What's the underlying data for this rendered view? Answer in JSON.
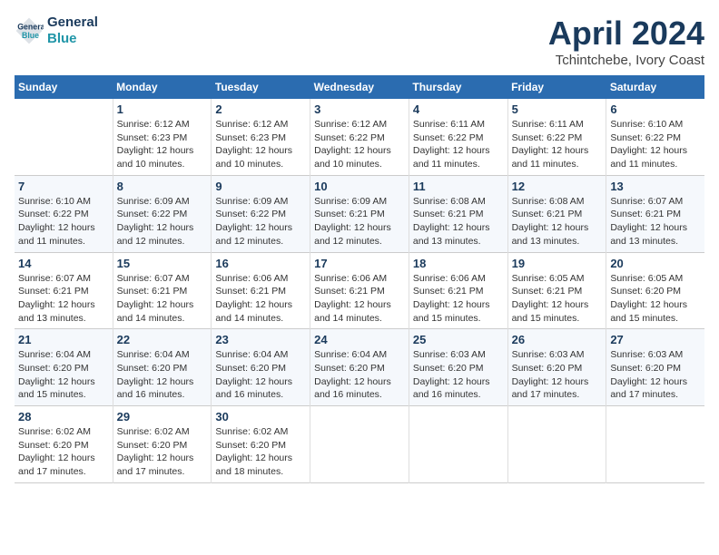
{
  "header": {
    "logo_line1": "General",
    "logo_line2": "Blue",
    "month_title": "April 2024",
    "location": "Tchintchebe, Ivory Coast"
  },
  "weekdays": [
    "Sunday",
    "Monday",
    "Tuesday",
    "Wednesday",
    "Thursday",
    "Friday",
    "Saturday"
  ],
  "weeks": [
    [
      {
        "num": "",
        "info": ""
      },
      {
        "num": "1",
        "info": "Sunrise: 6:12 AM\nSunset: 6:23 PM\nDaylight: 12 hours\nand 10 minutes."
      },
      {
        "num": "2",
        "info": "Sunrise: 6:12 AM\nSunset: 6:23 PM\nDaylight: 12 hours\nand 10 minutes."
      },
      {
        "num": "3",
        "info": "Sunrise: 6:12 AM\nSunset: 6:22 PM\nDaylight: 12 hours\nand 10 minutes."
      },
      {
        "num": "4",
        "info": "Sunrise: 6:11 AM\nSunset: 6:22 PM\nDaylight: 12 hours\nand 11 minutes."
      },
      {
        "num": "5",
        "info": "Sunrise: 6:11 AM\nSunset: 6:22 PM\nDaylight: 12 hours\nand 11 minutes."
      },
      {
        "num": "6",
        "info": "Sunrise: 6:10 AM\nSunset: 6:22 PM\nDaylight: 12 hours\nand 11 minutes."
      }
    ],
    [
      {
        "num": "7",
        "info": "Sunrise: 6:10 AM\nSunset: 6:22 PM\nDaylight: 12 hours\nand 11 minutes."
      },
      {
        "num": "8",
        "info": "Sunrise: 6:09 AM\nSunset: 6:22 PM\nDaylight: 12 hours\nand 12 minutes."
      },
      {
        "num": "9",
        "info": "Sunrise: 6:09 AM\nSunset: 6:22 PM\nDaylight: 12 hours\nand 12 minutes."
      },
      {
        "num": "10",
        "info": "Sunrise: 6:09 AM\nSunset: 6:21 PM\nDaylight: 12 hours\nand 12 minutes."
      },
      {
        "num": "11",
        "info": "Sunrise: 6:08 AM\nSunset: 6:21 PM\nDaylight: 12 hours\nand 13 minutes."
      },
      {
        "num": "12",
        "info": "Sunrise: 6:08 AM\nSunset: 6:21 PM\nDaylight: 12 hours\nand 13 minutes."
      },
      {
        "num": "13",
        "info": "Sunrise: 6:07 AM\nSunset: 6:21 PM\nDaylight: 12 hours\nand 13 minutes."
      }
    ],
    [
      {
        "num": "14",
        "info": "Sunrise: 6:07 AM\nSunset: 6:21 PM\nDaylight: 12 hours\nand 13 minutes."
      },
      {
        "num": "15",
        "info": "Sunrise: 6:07 AM\nSunset: 6:21 PM\nDaylight: 12 hours\nand 14 minutes."
      },
      {
        "num": "16",
        "info": "Sunrise: 6:06 AM\nSunset: 6:21 PM\nDaylight: 12 hours\nand 14 minutes."
      },
      {
        "num": "17",
        "info": "Sunrise: 6:06 AM\nSunset: 6:21 PM\nDaylight: 12 hours\nand 14 minutes."
      },
      {
        "num": "18",
        "info": "Sunrise: 6:06 AM\nSunset: 6:21 PM\nDaylight: 12 hours\nand 15 minutes."
      },
      {
        "num": "19",
        "info": "Sunrise: 6:05 AM\nSunset: 6:21 PM\nDaylight: 12 hours\nand 15 minutes."
      },
      {
        "num": "20",
        "info": "Sunrise: 6:05 AM\nSunset: 6:20 PM\nDaylight: 12 hours\nand 15 minutes."
      }
    ],
    [
      {
        "num": "21",
        "info": "Sunrise: 6:04 AM\nSunset: 6:20 PM\nDaylight: 12 hours\nand 15 minutes."
      },
      {
        "num": "22",
        "info": "Sunrise: 6:04 AM\nSunset: 6:20 PM\nDaylight: 12 hours\nand 16 minutes."
      },
      {
        "num": "23",
        "info": "Sunrise: 6:04 AM\nSunset: 6:20 PM\nDaylight: 12 hours\nand 16 minutes."
      },
      {
        "num": "24",
        "info": "Sunrise: 6:04 AM\nSunset: 6:20 PM\nDaylight: 12 hours\nand 16 minutes."
      },
      {
        "num": "25",
        "info": "Sunrise: 6:03 AM\nSunset: 6:20 PM\nDaylight: 12 hours\nand 16 minutes."
      },
      {
        "num": "26",
        "info": "Sunrise: 6:03 AM\nSunset: 6:20 PM\nDaylight: 12 hours\nand 17 minutes."
      },
      {
        "num": "27",
        "info": "Sunrise: 6:03 AM\nSunset: 6:20 PM\nDaylight: 12 hours\nand 17 minutes."
      }
    ],
    [
      {
        "num": "28",
        "info": "Sunrise: 6:02 AM\nSunset: 6:20 PM\nDaylight: 12 hours\nand 17 minutes."
      },
      {
        "num": "29",
        "info": "Sunrise: 6:02 AM\nSunset: 6:20 PM\nDaylight: 12 hours\nand 17 minutes."
      },
      {
        "num": "30",
        "info": "Sunrise: 6:02 AM\nSunset: 6:20 PM\nDaylight: 12 hours\nand 18 minutes."
      },
      {
        "num": "",
        "info": ""
      },
      {
        "num": "",
        "info": ""
      },
      {
        "num": "",
        "info": ""
      },
      {
        "num": "",
        "info": ""
      }
    ]
  ]
}
